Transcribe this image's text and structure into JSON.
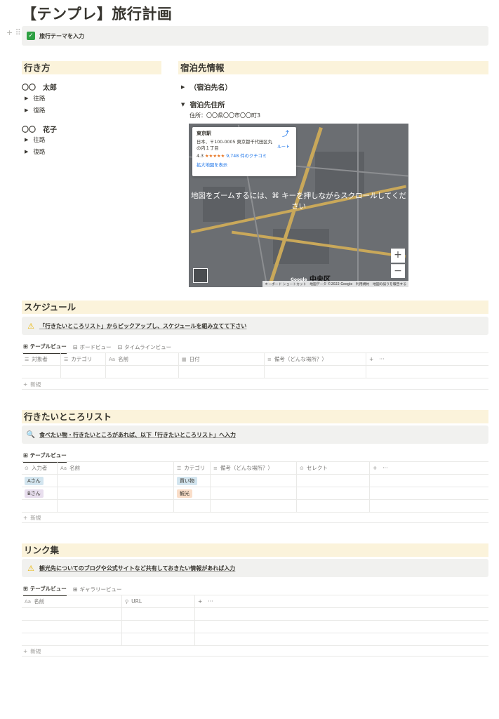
{
  "page": {
    "title": "【テンプレ】旅行計画",
    "theme_callout": "旅行テーマを入力"
  },
  "access": {
    "heading": "行き方",
    "people": [
      {
        "name": "〇〇　太郎",
        "outbound": "往路",
        "return": "復路"
      },
      {
        "name": "〇〇　花子",
        "outbound": "往路",
        "return": "復路"
      }
    ]
  },
  "lodging": {
    "heading": "宿泊先情報",
    "name_toggle": "（宿泊先名）",
    "address_toggle": "宿泊先住所",
    "address": "住所：〇〇県〇〇市〇〇町3",
    "map": {
      "place_name": "東京駅",
      "place_address": "日本、〒100-0005 東京都千代田区丸の内１丁目",
      "rating": "4.3",
      "stars": "★★★★★",
      "reviews": "9,748 件のクチコミ",
      "route_label": "ルート",
      "enlarge": "拡大地図を表示",
      "overlay": "地図をズームするには、⌘ キーを押しながらスクロールしてください",
      "zoom_in": "+",
      "zoom_out": "−",
      "district": "中央区",
      "google": "Google",
      "footer": "キーボード ショートカット　地図データ ©2022 Google　利用規約　地図の誤りを報告する"
    }
  },
  "schedule": {
    "heading": "スケジュール",
    "callout": "「行きたいところリスト」からピックアップし、スケジュールを組み立てて下さい",
    "views": [
      "テーブルビュー",
      "ボードビュー",
      "タイムラインビュー"
    ],
    "columns": [
      "対象者",
      "カテゴリ",
      "名前",
      "日付",
      "備考（どんな場所？）"
    ],
    "add_col": "+",
    "more": "···",
    "new_label": "新規"
  },
  "wishlist": {
    "heading": "行きたいところリスト",
    "callout": "食べたい物・行きたいところがあれば、以下「行きたいところリスト」へ入力",
    "views": [
      "テーブルビュー"
    ],
    "columns": [
      "入力者",
      "名前",
      "カテゴリ",
      "備考（どんな場所？）",
      "セレクト"
    ],
    "rows": [
      {
        "person": "Aさん",
        "category": "買い物"
      },
      {
        "person": "Bさん",
        "category": "観光"
      }
    ],
    "add_col": "+",
    "more": "···",
    "new_label": "新規"
  },
  "links": {
    "heading": "リンク集",
    "callout": "観光先についてのブログや公式サイトなど共有しておきたい情報があれば入力",
    "views": [
      "テーブルビュー",
      "ギャラリービュー"
    ],
    "columns": [
      "名前",
      "URL"
    ],
    "add_col": "+",
    "more": "···",
    "new_label": "新規"
  },
  "colors": {
    "heading_bg": "#fbf3db",
    "callout_bg": "#f1f1ef",
    "tag_a": "#d3e5ef",
    "tag_b": "#e8deee",
    "tag_shopping": "#d3e5ef",
    "tag_sightseeing": "#fadec9"
  }
}
